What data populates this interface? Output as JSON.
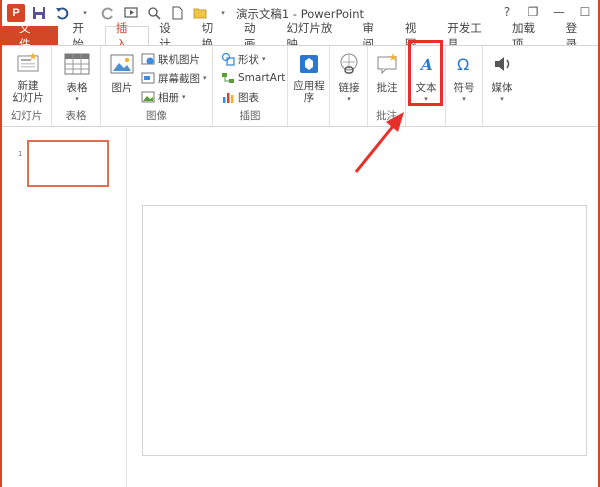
{
  "window": {
    "title": "演示文稿1 - PowerPoint"
  },
  "qat": {
    "logo_text": "P"
  },
  "window_controls": {
    "help": "?",
    "restore": "❐",
    "minimize": "—",
    "maximize": "☐"
  },
  "tabs": [
    {
      "label": "文件"
    },
    {
      "label": "开始"
    },
    {
      "label": "插入"
    },
    {
      "label": "设计"
    },
    {
      "label": "切换"
    },
    {
      "label": "动画"
    },
    {
      "label": "幻灯片放映"
    },
    {
      "label": "审阅"
    },
    {
      "label": "视图"
    },
    {
      "label": "开发工具"
    },
    {
      "label": "加载项"
    },
    {
      "label": "登录"
    }
  ],
  "ribbon": {
    "slides": {
      "new_slide": "新建\n幻灯片",
      "group": "幻灯片"
    },
    "tables": {
      "table": "表格",
      "group": "表格"
    },
    "images": {
      "picture": "图片",
      "online_pictures": "联机图片",
      "screenshot": "屏幕截图",
      "album": "相册",
      "group": "图像"
    },
    "illustrations": {
      "shapes": "形状",
      "smartart": "SmartArt",
      "chart": "图表",
      "group": "插图"
    },
    "apps": {
      "apps_for_office": "应用程\n序"
    },
    "links": {
      "link": "链接"
    },
    "comments": {
      "comment": "批注",
      "group": "批注"
    },
    "text": {
      "text": "文本"
    },
    "symbols": {
      "symbol": "符号"
    },
    "media": {
      "media": "媒体"
    }
  },
  "slides_pane": {
    "slide_number": "1"
  },
  "colors": {
    "accent": "#d24726",
    "highlight": "#e8302b"
  }
}
